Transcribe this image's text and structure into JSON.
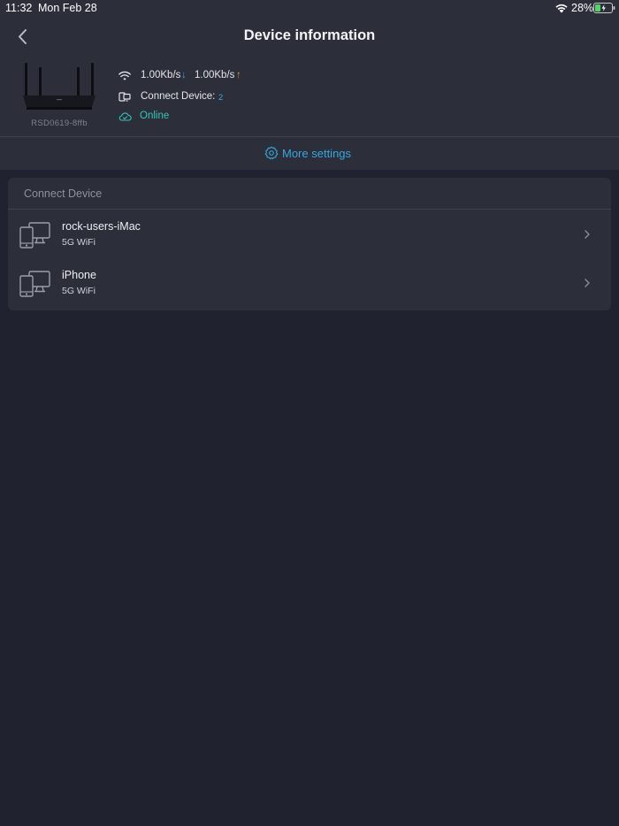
{
  "status_bar": {
    "time": "11:32",
    "date": "Mon Feb 28",
    "battery": "28%"
  },
  "header": {
    "title": "Device information"
  },
  "router": {
    "id_label": "RSD0619-8ffb",
    "download_speed": "1.00Kb/s",
    "download_arrow": "↓",
    "upload_speed": "1.00Kb/s",
    "upload_arrow": "↑",
    "connect_label": "Connect Device:",
    "connect_count": "2",
    "status": "Online"
  },
  "more_settings": {
    "label": "More settings"
  },
  "connect_device": {
    "header": "Connect Device",
    "devices": [
      {
        "name": "rock-users-iMac",
        "connection": "5G WiFi"
      },
      {
        "name": "iPhone",
        "connection": "5G WiFi"
      }
    ]
  },
  "colors": {
    "accent_blue": "#36a7e0",
    "online_teal": "#2ccab6",
    "upload_orange": "#ee8a3c",
    "background": "#20222f",
    "panel": "#2c2e3a",
    "battery_green": "#4cd964"
  },
  "icons": [
    "back-chevron-icon",
    "wifi-icon",
    "devices-icon",
    "cloud-icon",
    "gear-icon",
    "computer-phone-icon",
    "chevron-right-icon"
  ]
}
